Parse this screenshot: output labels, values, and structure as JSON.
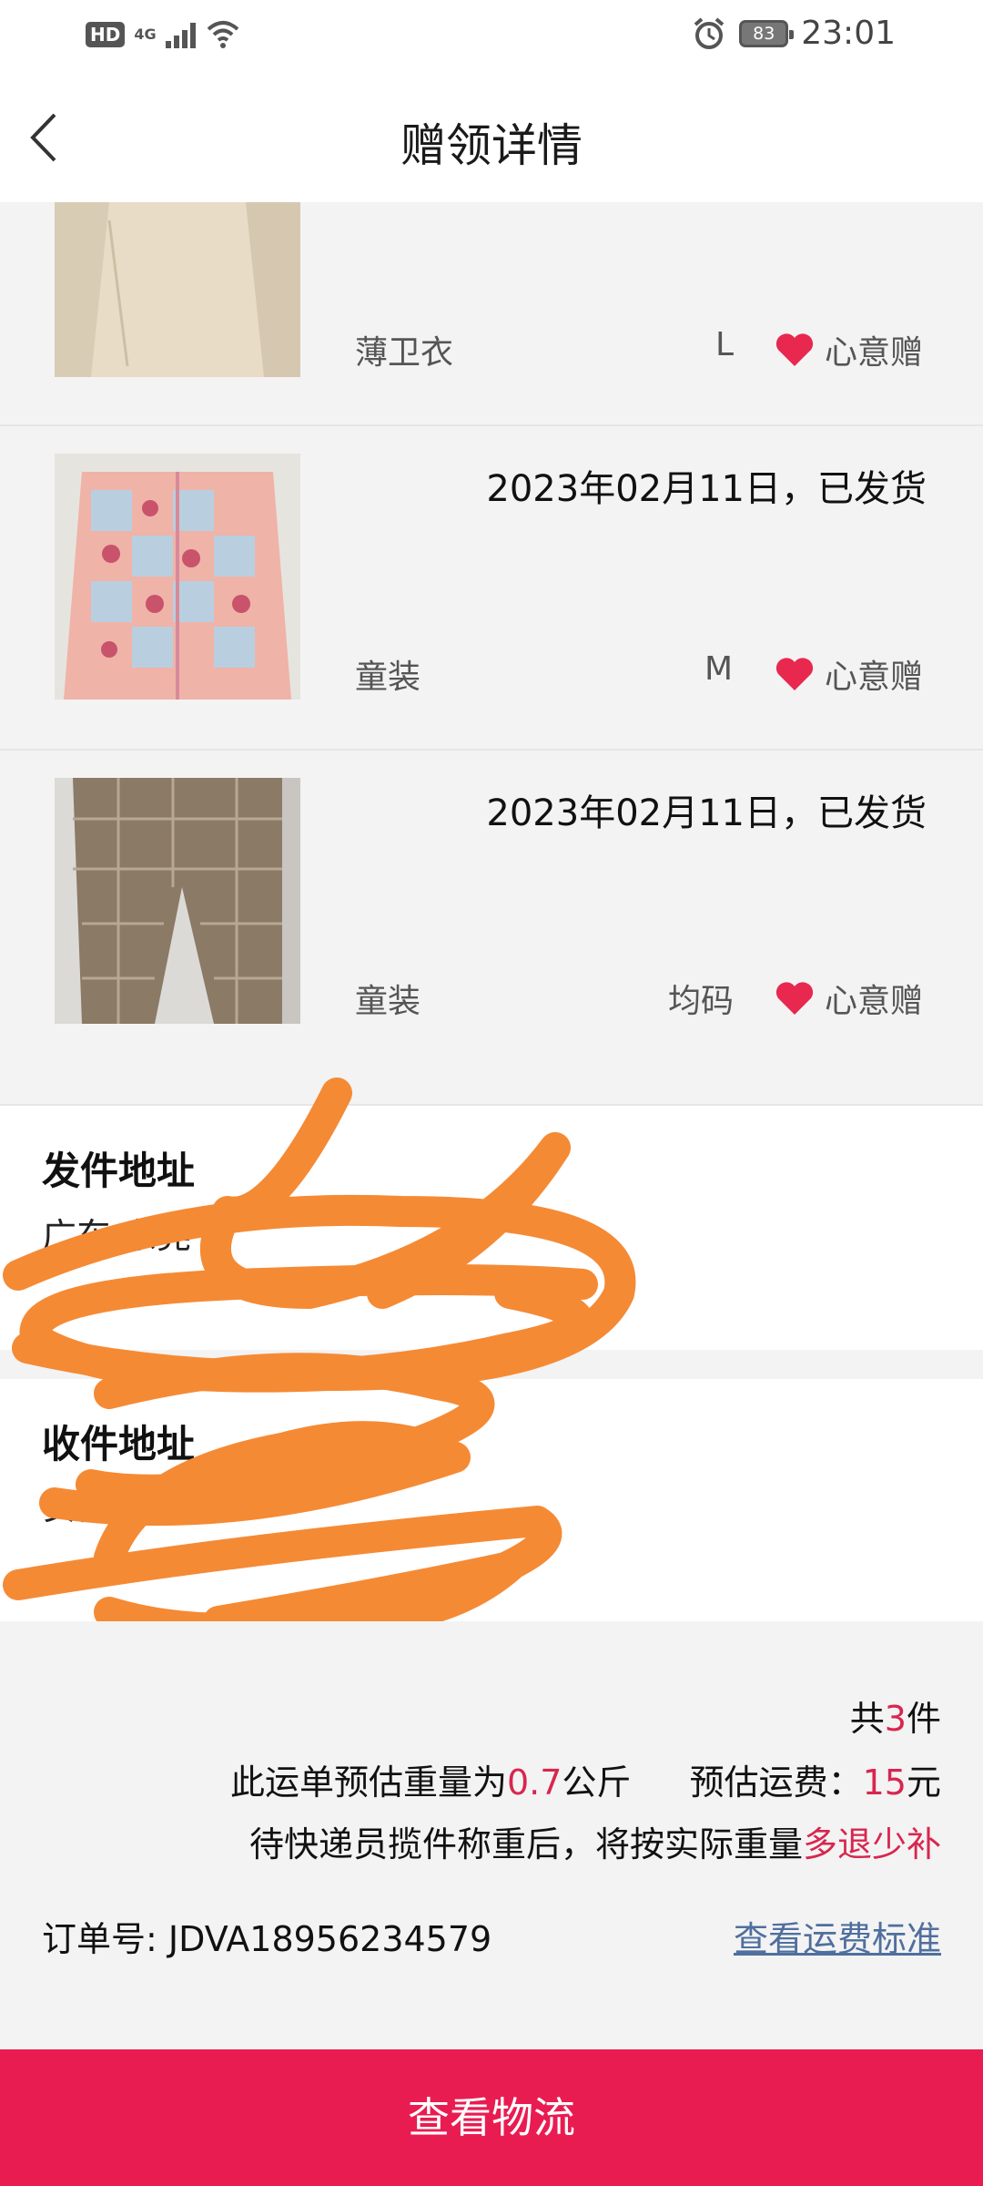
{
  "status_bar": {
    "hd": "HD",
    "network": "4G",
    "battery": "83",
    "time": "23:01",
    "icons": [
      "signal-icon",
      "wifi-icon",
      "alarm-icon",
      "battery-icon"
    ]
  },
  "nav": {
    "title": "赠领详情",
    "back_icon": "chevron-left-icon"
  },
  "items": [
    {
      "date": "",
      "category": "薄卫衣",
      "size": "L",
      "gift_label": "心意赠"
    },
    {
      "date": "2023年02月11日，已发货",
      "category": "童装",
      "size": "M",
      "gift_label": "心意赠"
    },
    {
      "date": "2023年02月11日，已发货",
      "category": "童装",
      "size": "均码",
      "gift_label": "心意赠"
    }
  ],
  "sender": {
    "title": "发件地址",
    "line1": "广东 东莞"
  },
  "receiver": {
    "title": "收件地址",
    "line1": "安徽 合肥"
  },
  "summary": {
    "count_prefix": "共",
    "count": "3",
    "count_suffix": "件",
    "weight_prefix": "此运单预估重量为",
    "weight": "0.7",
    "weight_unit": "公斤",
    "fee_prefix": "预估运费：",
    "fee": "15",
    "fee_unit": "元",
    "note_prefix": "待快递员揽件称重后，将按实际重量",
    "note_highlight": "多退少补",
    "order_label": "订单号:",
    "order_no": "JDVA18956234579",
    "fee_standard_link": "查看运费标准"
  },
  "bottom_button": "查看物流",
  "colors": {
    "accent": "#e91c52",
    "highlight_text": "#d8264f",
    "link": "#4f6f9e",
    "redaction": "#f58a35"
  }
}
